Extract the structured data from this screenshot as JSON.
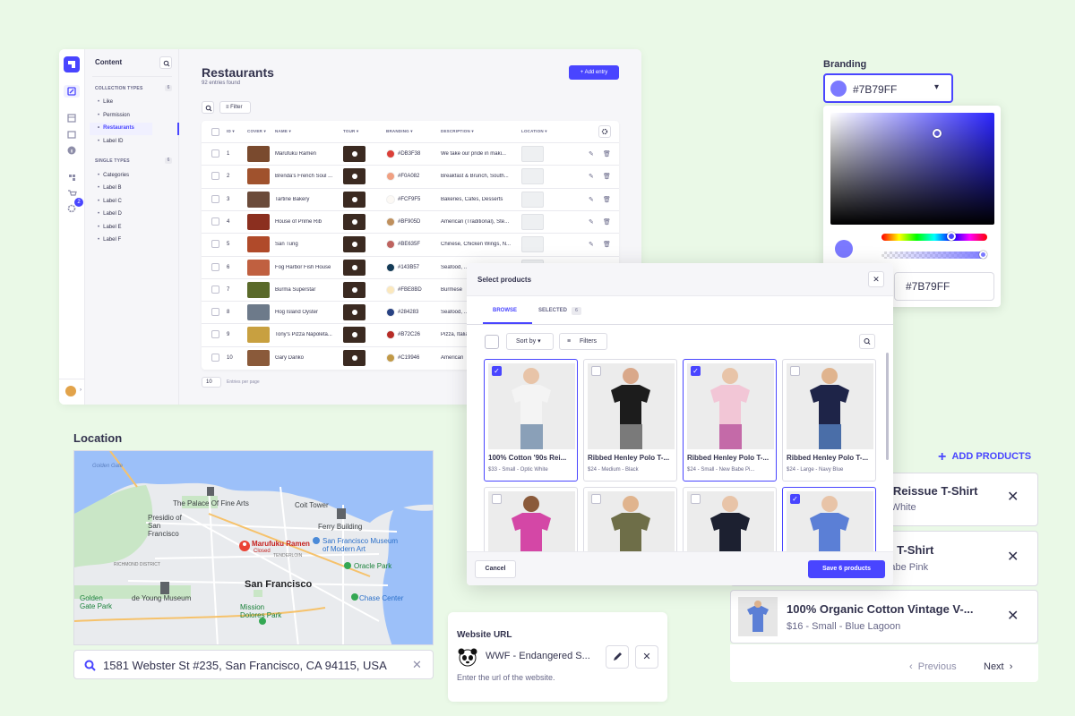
{
  "cms": {
    "sidebar_title": "Content",
    "collection_types_heading": "COLLECTION TYPES",
    "collection_types_count": "6",
    "collection_items": [
      "Like",
      "Permission",
      "Restaurants",
      "Label ID"
    ],
    "single_types_heading": "SINGLE TYPES",
    "single_types_count": "6",
    "single_items": [
      "Categories",
      "Label B",
      "Label C",
      "Label D",
      "Label E",
      "Label F"
    ],
    "notification_count": "2",
    "page_title": "Restaurants",
    "page_subtitle": "92 entries found",
    "add_entry_label": "+ Add entry",
    "filter_label": "Filter",
    "columns": [
      "ID",
      "COVER",
      "NAME",
      "TOUR",
      "BRANDING",
      "DESCRIPTION",
      "LOCATION"
    ],
    "rows": [
      {
        "id": "1",
        "name": "Marufuku Ramen",
        "hex": "#DB3F38",
        "color": "#DB3F38",
        "desc": "We take our pride in maki...",
        "cover": "#7a4a2e"
      },
      {
        "id": "2",
        "name": "Brenda's French Soul ...",
        "hex": "#F0A082",
        "color": "#F0A082",
        "desc": "Breakfast & Brunch, South...",
        "cover": "#a0522d"
      },
      {
        "id": "3",
        "name": "Tartine Bakery",
        "hex": "#FCF9F5",
        "color": "#FCF9F5",
        "desc": "Bakeries, Cafes, Desserts",
        "cover": "#6b4b3a"
      },
      {
        "id": "4",
        "name": "House of Prime Rib",
        "hex": "#BF905D",
        "color": "#BF905D",
        "desc": "American (Traditional), Ste...",
        "cover": "#8b2f1f"
      },
      {
        "id": "5",
        "name": "San Tung",
        "hex": "#BE635F",
        "color": "#BE635F",
        "desc": "Chinese, Chicken Wings, N...",
        "cover": "#b04a2a"
      },
      {
        "id": "6",
        "name": "Fog Harbor Fish House",
        "hex": "#143B57",
        "color": "#143B57",
        "desc": "Seafood, ...",
        "cover": "#c06040"
      },
      {
        "id": "7",
        "name": "Burma Superstar",
        "hex": "#FBE8BD",
        "color": "#FBE8BD",
        "desc": "Burmese",
        "cover": "#5a6a2a"
      },
      {
        "id": "8",
        "name": "Hog Island Oyster",
        "hex": "#284283",
        "color": "#284283",
        "desc": "Seafood, ...",
        "cover": "#6d7a8a"
      },
      {
        "id": "9",
        "name": "Tony's Pizza Napoleta...",
        "hex": "#B72C26",
        "color": "#B72C26",
        "desc": "Pizza, Italian",
        "cover": "#c8a040"
      },
      {
        "id": "10",
        "name": "Gary Danko",
        "hex": "#C19946",
        "color": "#C19946",
        "desc": "American",
        "cover": "#8a5a3a"
      }
    ],
    "per_page": "10",
    "per_page_label": "Entries per page"
  },
  "branding": {
    "label": "Branding",
    "value": "#7B79FF",
    "hex_input": "#7B79FF",
    "color": "#7B79FF"
  },
  "location": {
    "label": "Location",
    "address": "1581 Webster St #235, San Francisco, CA 94115, USA",
    "map_labels": {
      "golden_gate": "Golden Gate",
      "palace": "The Palace Of Fine Arts",
      "coit": "Coit Tower",
      "presidio": "Presidio of San Francisco",
      "ferry": "Ferry Building",
      "marufuku": "Marufuku Ramen",
      "closed": "Closed",
      "museum": "San Francisco Museum of Modern Art",
      "oracle": "Oracle Park",
      "sf": "San Francisco",
      "deyoung": "de Young Museum",
      "gg_park": "Golden Gate Park",
      "mission": "Mission Dolores Park",
      "chase": "Chase Center",
      "richmond": "RICHMOND DISTRICT",
      "tenderloin": "TENDERLOIN"
    }
  },
  "website": {
    "label": "Website URL",
    "value": "WWF - Endangered S...",
    "hint": "Enter the url of the website."
  },
  "modal": {
    "title": "Select products",
    "tab_browse": "BROWSE",
    "tab_selected": "SELECTED",
    "selected_count": "6",
    "sort_label": "Sort by",
    "filters_label": "Filters",
    "cancel_label": "Cancel",
    "save_label": "Save 6 products",
    "products": [
      {
        "title": "100% Cotton '90s Rei...",
        "meta": "$33 - Small - Optic White",
        "selected": true,
        "shirt": "#f4f4f4",
        "pants": "#8aa0b8",
        "skin": "#e8c4a8"
      },
      {
        "title": "Ribbed Henley Polo T-...",
        "meta": "$24 - Medium - Black",
        "selected": false,
        "shirt": "#1c1c1c",
        "pants": "#7a7a7a",
        "skin": "#d9a88a"
      },
      {
        "title": "Ribbed Henley Polo T-...",
        "meta": "$24 - Small - New Babe Pi...",
        "selected": true,
        "shirt": "#f2c6d6",
        "pants": "#c46aa8",
        "skin": "#e8c4a8"
      },
      {
        "title": "Ribbed Henley Polo T-...",
        "meta": "$24 - Large - Navy Blue",
        "selected": false,
        "shirt": "#1e2448",
        "pants": "#4a6ea8",
        "skin": "#e0b48e"
      },
      {
        "title": "",
        "meta": "",
        "selected": false,
        "shirt": "#d447a6",
        "pants": "#d447a6",
        "skin": "#8a5a3a"
      },
      {
        "title": "",
        "meta": "",
        "selected": false,
        "shirt": "#6e6e48",
        "pants": "#6e6e48",
        "skin": "#e0b48e"
      },
      {
        "title": "",
        "meta": "",
        "selected": false,
        "shirt": "#1c2030",
        "pants": "#1c2030",
        "skin": "#e8c4a8"
      },
      {
        "title": "",
        "meta": "",
        "selected": true,
        "shirt": "#5b7fd6",
        "pants": "#5b7fd6",
        "skin": "#e8c4a8"
      }
    ]
  },
  "selected_panel": {
    "add_label": "ADD PRODUCTS",
    "items": [
      {
        "name": "s Reissue T-Shirt",
        "meta": "c White"
      },
      {
        "name": "lo T-Shirt",
        "meta": "Babe Pink"
      },
      {
        "name": "100% Organic Cotton Vintage V-...",
        "meta": "$16  -  Small  -  Blue Lagoon"
      }
    ],
    "previous_label": "Previous",
    "next_label": "Next"
  }
}
